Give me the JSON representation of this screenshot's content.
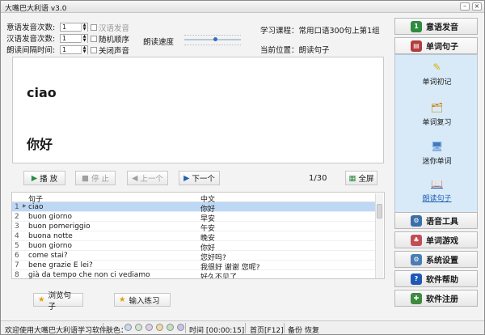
{
  "title": "大嘴巴大利语 v3.0",
  "settings": {
    "yi_count_label": "意语发音次数:",
    "yi_count": "1",
    "cn_count_label": "汉语发音次数:",
    "cn_count": "1",
    "interval_label": "朗读间隔时间:",
    "interval": "1",
    "cn_voice_label": "汉语发音",
    "random_label": "随机顺序",
    "mute_label": "关闭声音",
    "speed_label": "朗读速度",
    "speed_value": 0.5
  },
  "info": {
    "course": "学习课程：常用口语300句上第1组",
    "position": "当前位置：朗读句子"
  },
  "display": {
    "word": "ciao",
    "translation": "你好"
  },
  "controls": {
    "play": "播 放",
    "stop": "停 止",
    "prev": "上一个",
    "next": "下一个",
    "count": "1/30",
    "fullscreen": "全屏"
  },
  "table": {
    "col1": "句子",
    "col2": "中文",
    "rows": [
      {
        "n": "1",
        "a": "ciao",
        "b": "你好"
      },
      {
        "n": "2",
        "a": "buon giorno",
        "b": "早安"
      },
      {
        "n": "3",
        "a": "buon pomeriggio",
        "b": "午安"
      },
      {
        "n": "4",
        "a": "buona notte",
        "b": "晚安"
      },
      {
        "n": "5",
        "a": "buon giorno",
        "b": "你好"
      },
      {
        "n": "6",
        "a": "come stai?",
        "b": "您好吗?"
      },
      {
        "n": "7",
        "a": "bene grazie E lei?",
        "b": "我很好 谢谢 您呢?"
      },
      {
        "n": "8",
        "a": "già da tempo che non ci vediamo",
        "b": "好久不见了"
      }
    ]
  },
  "bottom": {
    "browse": "浏览句子",
    "input": "输入练习"
  },
  "sidebar": {
    "items": [
      {
        "label": "意语发音"
      },
      {
        "label": "单词句子"
      },
      {
        "label": "语音工具"
      },
      {
        "label": "单词游戏"
      },
      {
        "label": "系统设置"
      },
      {
        "label": "软件帮助"
      },
      {
        "label": "软件注册"
      }
    ],
    "subitems": [
      {
        "label": "单词初记"
      },
      {
        "label": "单词复习"
      },
      {
        "label": "迷你单词"
      },
      {
        "label": "朗读句子"
      }
    ]
  },
  "status": {
    "welcome": "欢迎使用大嘴巴大利语学习软件",
    "skin": "肤色：",
    "time": "时间 [00:00:15]",
    "home": "首页[F12]",
    "backup": "备份",
    "restore": "恢复"
  },
  "colors": {
    "accent": "#2a6fc4",
    "selected": "#bcd8f5",
    "skin1": "#c8d8ee",
    "skin2": "#cfe6cf",
    "skin3": "#dfcdeb",
    "skin4": "#efdba2",
    "skin5": "#bfe1bf",
    "skin6": "#c5c2f0"
  }
}
